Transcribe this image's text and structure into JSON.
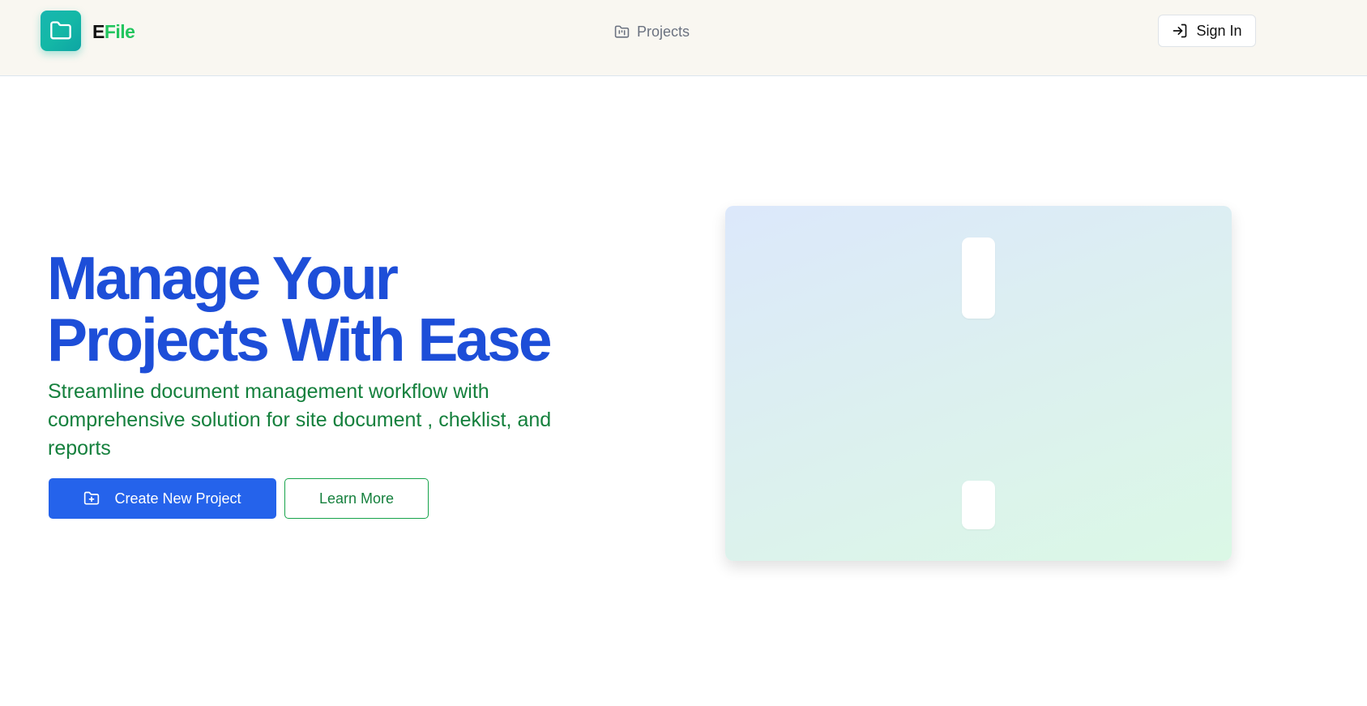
{
  "header": {
    "brand_first": "E",
    "brand_rest": "File",
    "logo_icon": "folder-icon",
    "nav_projects_label": "Projects",
    "nav_projects_icon": "folder-kanban-icon",
    "signin_label": "Sign In",
    "signin_icon": "log-in-icon"
  },
  "hero": {
    "headline_line1": "Manage Your",
    "headline_line2": "Projects With Ease",
    "subtitle": "Streamline document management workflow with comprehensive solution for site document , cheklist, and reports",
    "primary_button_label": "Create New Project",
    "primary_button_icon": "folder-plus-icon",
    "secondary_button_label": "Learn More"
  },
  "colors": {
    "brand_green": "#22c55e",
    "headline_blue": "#1d4ed8",
    "primary_button": "#2563eb",
    "subtitle_green": "#15803d",
    "logo_teal": "#14b8a6"
  }
}
